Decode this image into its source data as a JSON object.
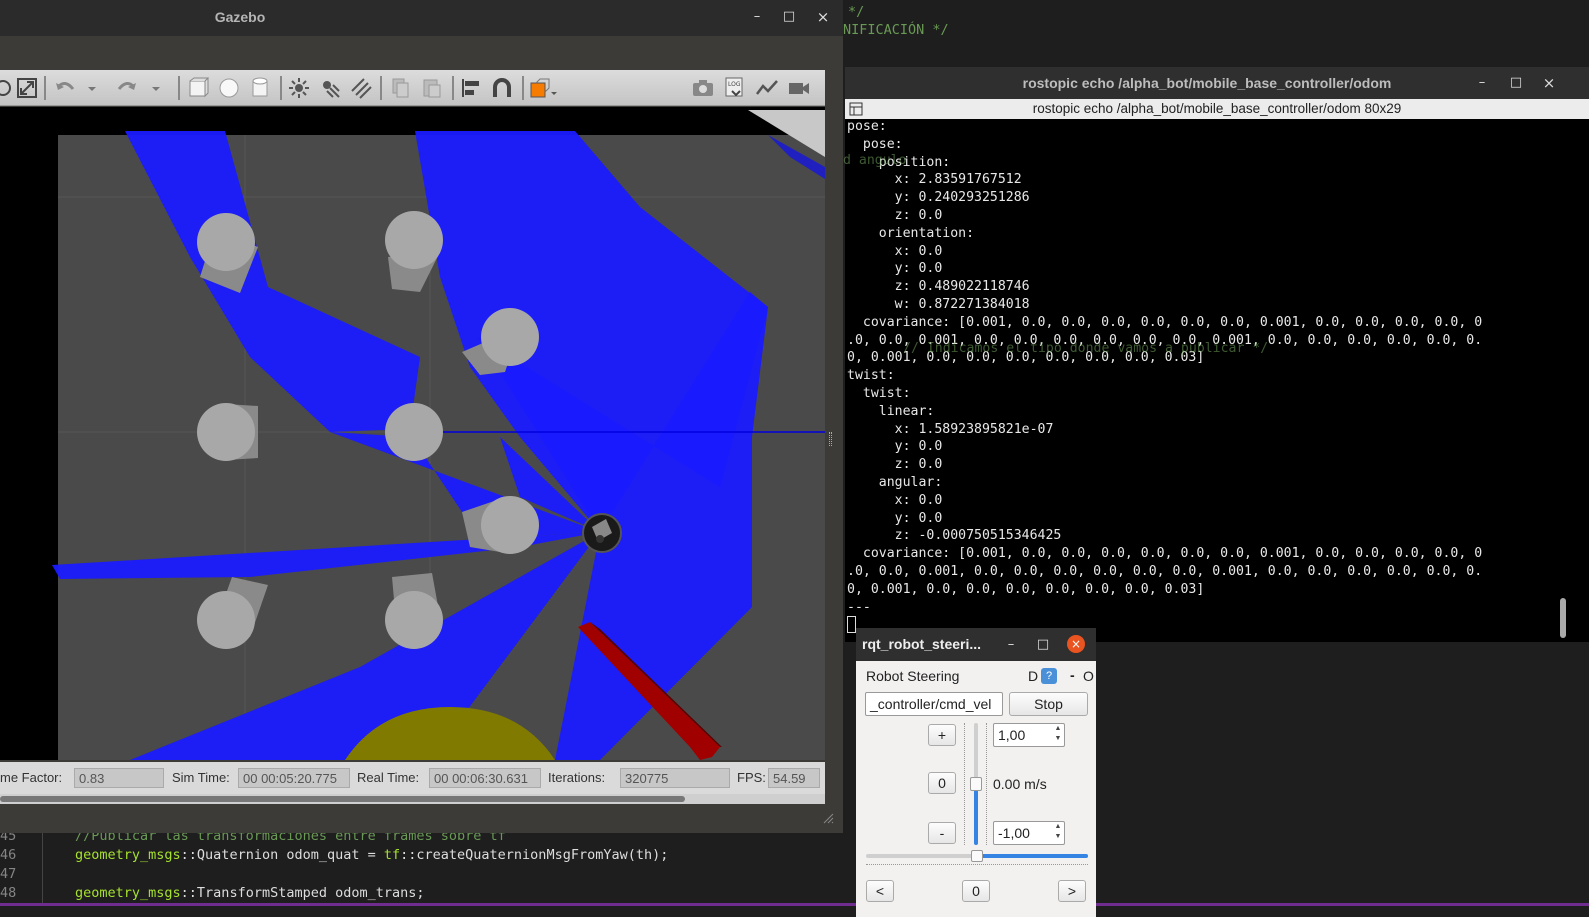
{
  "editor": {
    "top_lines": [
      "*/",
      "NIFICACIÓN */"
    ],
    "bottom_gutter": [
      "45",
      "46",
      "47",
      "48"
    ],
    "bottom_lines": [
      "//Publicar las transformaciones entre frames sobre tf",
      "geometry_msgs::Quaternion odom_quat = tf::createQuaternionMsgFromYaw(th);",
      "",
      "geometry_msgs::TransformStamped odom_trans;"
    ],
    "ghost_lines": [
      "d angulo",
      "// Indicamos el tipo donde vamos a publicar */"
    ]
  },
  "gazebo": {
    "title": "Gazebo",
    "window_buttons": [
      "–",
      "□",
      "×"
    ],
    "toolbar_icons": [
      "translate-icon",
      "fullscreen-icon",
      "undo-icon",
      "undo-dropdown-icon",
      "redo-icon",
      "redo-dropdown-icon",
      "box-icon",
      "sphere-icon",
      "cylinder-icon",
      "point-light-icon",
      "spot-light-icon",
      "directional-light-icon",
      "copy-icon",
      "paste-icon",
      "align-icon",
      "snap-icon",
      "view-angle-icon",
      "screenshot-icon",
      "log-icon",
      "plot-icon",
      "record-video-icon"
    ],
    "status": {
      "time_factor_label": "me Factor:",
      "time_factor": "0.83",
      "sim_time_label": "Sim Time:",
      "sim_time": "00 00:05:20.775",
      "real_time_label": "Real Time:",
      "real_time": "00 00:06:30.631",
      "iterations_label": "Iterations:",
      "iterations": "320775",
      "fps_label": "FPS:",
      "fps": "54.59"
    },
    "colors": {
      "laser": "#1a1aff",
      "ground": "#4a4a4a",
      "obstacle": "#a8a8a8",
      "red_wall": "#a00000",
      "yellow_disc": "#807a00"
    }
  },
  "terminal": {
    "title": "rostopic echo /alpha_bot/mobile_base_controller/odom",
    "window_buttons": [
      "–",
      "□",
      "×"
    ],
    "subtitle": "rostopic echo /alpha_bot/mobile_base_controller/odom 80x29",
    "lines": [
      "pose:",
      "  pose:",
      "    position:",
      "      x: 2.83591767512",
      "      y: 0.240293251286",
      "      z: 0.0",
      "    orientation:",
      "      x: 0.0",
      "      y: 0.0",
      "      z: 0.489022118746",
      "      w: 0.872271384018",
      "  covariance: [0.001, 0.0, 0.0, 0.0, 0.0, 0.0, 0.0, 0.001, 0.0, 0.0, 0.0, 0.0, 0",
      ".0, 0.0, 0.001, 0.0, 0.0, 0.0, 0.0, 0.0, 0.0, 0.001, 0.0, 0.0, 0.0, 0.0, 0.0, 0.",
      "0, 0.001, 0.0, 0.0, 0.0, 0.0, 0.0, 0.0, 0.03]",
      "twist:",
      "  twist:",
      "    linear:",
      "      x: 1.58923895821e-07",
      "      y: 0.0",
      "      z: 0.0",
      "    angular:",
      "      x: 0.0",
      "      y: 0.0",
      "      z: -0.000750515346425",
      "  covariance: [0.001, 0.0, 0.0, 0.0, 0.0, 0.0, 0.0, 0.001, 0.0, 0.0, 0.0, 0.0, 0",
      ".0, 0.0, 0.001, 0.0, 0.0, 0.0, 0.0, 0.0, 0.0, 0.001, 0.0, 0.0, 0.0, 0.0, 0.0, 0.",
      "0, 0.001, 0.0, 0.0, 0.0, 0.0, 0.0, 0.0, 0.03]",
      "---"
    ]
  },
  "rqt": {
    "title": "rqt_robot_steeri...",
    "window_buttons": [
      "–",
      "□",
      "×"
    ],
    "plugin_label": "Robot Steering",
    "plugin_buttons": [
      "D",
      "?",
      "-",
      "O"
    ],
    "topic": "_controller/cmd_vel",
    "stop_label": "Stop",
    "plus_label": "+",
    "minus_label": "-",
    "linear_zero": "0",
    "linear_max": "1,00",
    "linear_min": "-1,00",
    "linear_value": "0.00 m/s",
    "angular_left": "<",
    "angular_right": ">",
    "angular_zero": "0",
    "linear_level": 0.0,
    "angular_level": 0.0
  }
}
